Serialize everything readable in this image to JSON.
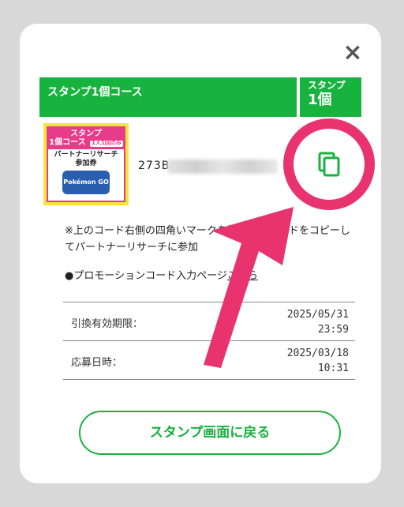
{
  "header": {
    "course_title": "スタンプ1個コース",
    "stamp_label": "スタンプ",
    "stamp_count": "1個"
  },
  "ticket": {
    "top_line": "スタンプ",
    "course": "1個コース",
    "badge": "1人1回のみ",
    "line1": "パートナーリサーチ",
    "line2": "参加券",
    "logo": "Pokémon GO"
  },
  "code": {
    "visible_prefix": "273B"
  },
  "note": {
    "text": "※上のコード右側の四角いマークを押し　　コードをコピーしてパートナーリサーチに参加"
  },
  "promo": {
    "prefix": "●プロモーションコード入力ページ",
    "link": "こちら"
  },
  "details": [
    {
      "label": "引換有効期限：",
      "date": "2025/05/31",
      "time": "23:59"
    },
    {
      "label": "応募日時：",
      "date": "2025/03/18",
      "time": "10:31"
    }
  ],
  "back_button": "スタンプ画面に戻る",
  "close_icon": "×",
  "colors": {
    "green": "#18b23f",
    "pink": "#e8336e"
  }
}
